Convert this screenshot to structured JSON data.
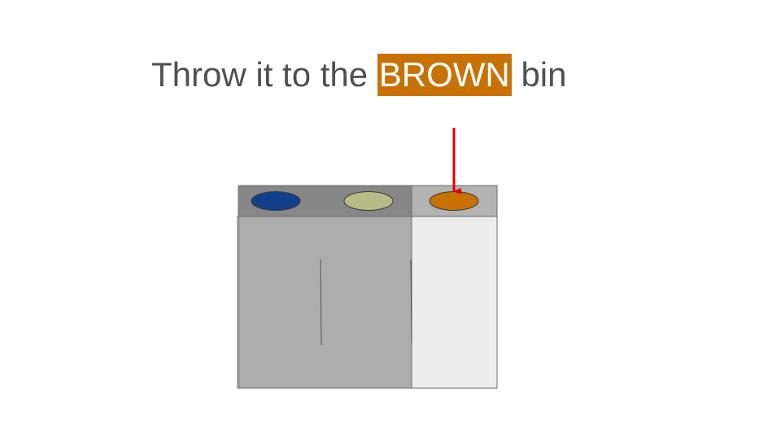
{
  "instruction": {
    "prefix": "Throw it to the ",
    "keyword": "BROWN",
    "suffix": " bin"
  },
  "colors": {
    "keyword_highlight": "#c87206",
    "text": "#505050",
    "arrow": "#e00000",
    "lid_blue": "#123f8c",
    "lid_olive": "#b7bb85",
    "lid_brown": "#c87206",
    "bin_gray": "#adadad",
    "bin_light": "#ededed",
    "top_dark": "#878787",
    "top_light": "#b3b3b3"
  },
  "bins": [
    {
      "color_name": "blue",
      "selected": false
    },
    {
      "color_name": "olive",
      "selected": false
    },
    {
      "color_name": "brown",
      "selected": true
    }
  ]
}
